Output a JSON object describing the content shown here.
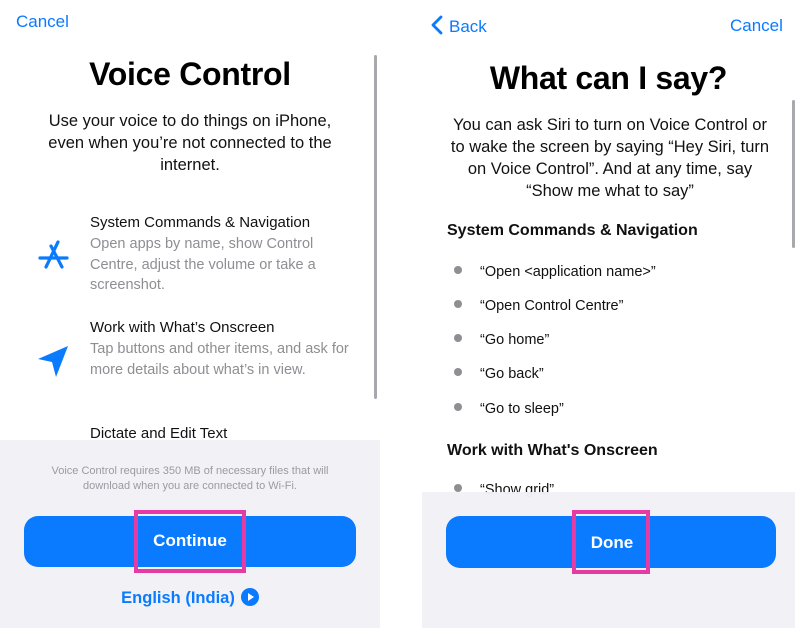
{
  "left": {
    "cancel_label": "Cancel",
    "title": "Voice Control",
    "intro": "Use your voice to do things on iPhone, even when you’re not connected to the internet.",
    "features": [
      {
        "icon": "app-store-icon",
        "title": "System Commands & Navigation",
        "desc": "Open apps by name, show Control Centre, adjust the volume or take a screenshot."
      },
      {
        "icon": "navigation-arrow-icon",
        "title": "Work with What’s Onscreen",
        "desc": "Tap buttons and other items, and ask for more details about what’s in view."
      },
      {
        "icon": "",
        "title": "Dictate and Edit Text",
        "desc": ""
      }
    ],
    "footnote": "Voice Control requires 350 MB of necessary files that will download when you are connected to Wi-Fi.",
    "continue_label": "Continue",
    "language_label": "English (India)"
  },
  "right": {
    "back_label": "Back",
    "cancel_label": "Cancel",
    "title": "What can I say?",
    "intro": "You can ask Siri to turn on Voice Control or to wake the screen by saying “Hey Siri, turn on Voice Control”. And at any time, say “Show me what to say”",
    "section1": "System Commands & Navigation",
    "commands": [
      "“Open <application name>”",
      "“Open Control Centre”",
      "“Go home”",
      "“Go back”",
      "“Go to sleep”"
    ],
    "section2": "Work with What's Onscreen",
    "partial_command": "“Show grid”",
    "done_label": "Done"
  },
  "colors": {
    "accent": "#0a7aff",
    "highlight": "#e43ba4",
    "secondary_text": "#8e8e93"
  }
}
